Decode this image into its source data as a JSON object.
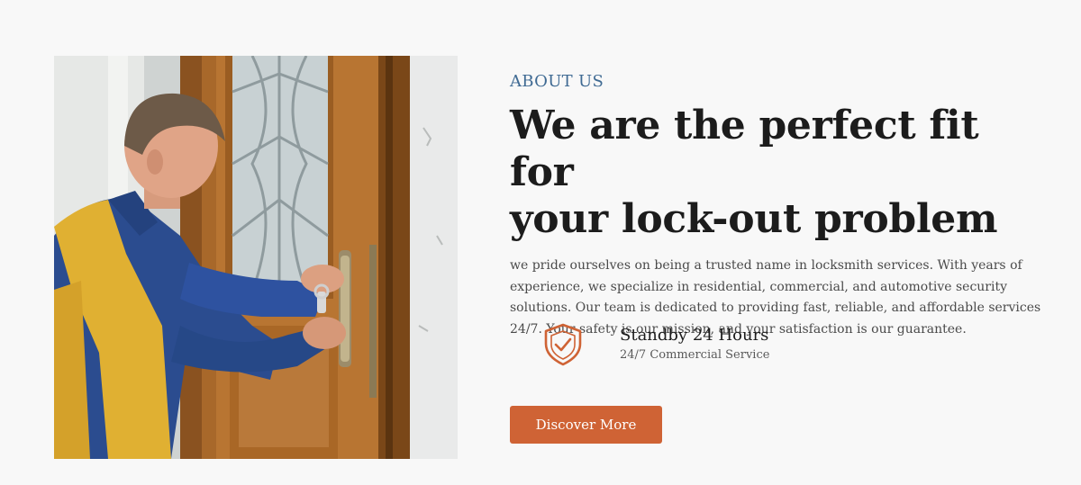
{
  "about": {
    "eyebrow": "ABOUT US",
    "headline_line1": "We are the perfect fit for",
    "headline_line2": "your lock-out problem",
    "body": "we pride ourselves on being a trusted name in locksmith services. With years of experience, we specialize in residential, commercial, and automotive security solutions. Our team is dedicated to providing fast, reliable, and affordable services 24/7. Your safety is our mission, and your satisfaction is our guarantee.",
    "feature": {
      "icon": "shield-check-icon",
      "title": "Standby 24 Hours",
      "subtitle": "24/7 Commercial Service"
    },
    "cta_label": "Discover More"
  },
  "theme": {
    "accent": "#cf6335",
    "eyebrow_color": "#3f6a93",
    "heading_color": "#1c1c1c",
    "background": "#f8f8f8"
  }
}
